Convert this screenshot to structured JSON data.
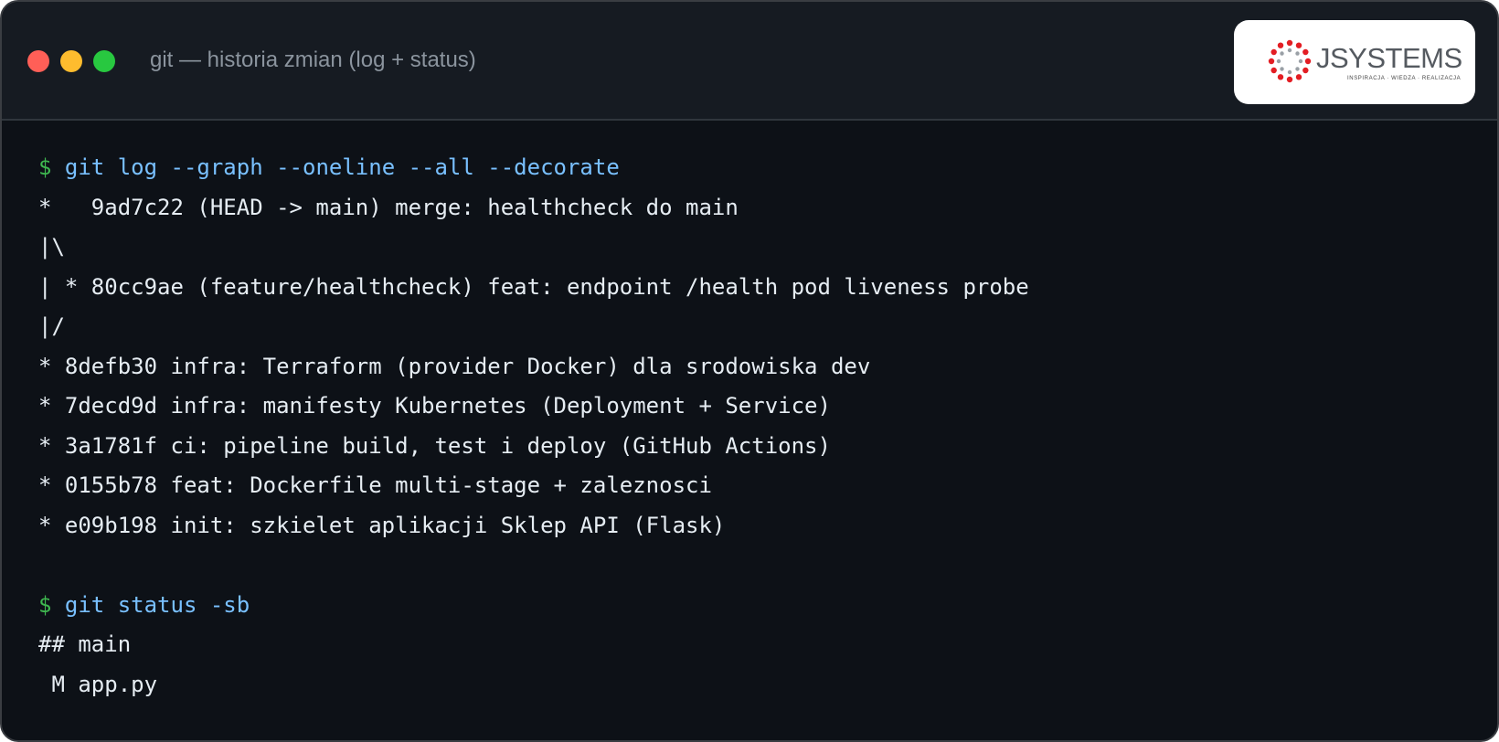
{
  "window": {
    "title": "git — historia zmian (log + status)"
  },
  "logo": {
    "name": "JSYSTEMS",
    "tagline": "INSPIRACJA · WIEDZA · REALIZACJA"
  },
  "terminal": {
    "prompt_symbol": "$",
    "command1": "git log --graph --oneline --all --decorate",
    "log_lines": [
      "*   9ad7c22 (HEAD -> main) merge: healthcheck do main",
      "|\\",
      "| * 80cc9ae (feature/healthcheck) feat: endpoint /health pod liveness probe",
      "|/",
      "* 8defb30 infra: Terraform (provider Docker) dla srodowiska dev",
      "* 7decd9d infra: manifesty Kubernetes (Deployment + Service)",
      "* 3a1781f ci: pipeline build, test i deploy (GitHub Actions)",
      "* 0155b78 feat: Dockerfile multi-stage + zaleznosci",
      "* e09b198 init: szkielet aplikacji Sklep API (Flask)"
    ],
    "command2": "git status -sb",
    "status_lines": [
      "## main",
      " M app.py"
    ]
  },
  "colors": {
    "background": "#0d1117",
    "titlebar": "#161b22",
    "prompt": "#3fb950",
    "command": "#79c0ff",
    "text": "#e6edf3",
    "dot_red": "#ff5f57",
    "dot_yellow": "#febc2e",
    "dot_green": "#28c840",
    "logo_red": "#e31e24"
  }
}
